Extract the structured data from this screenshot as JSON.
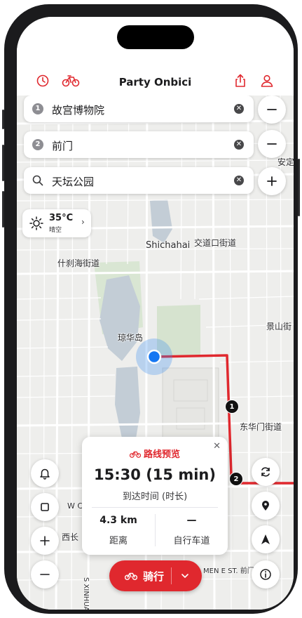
{
  "app": {
    "title": "Party Onbici",
    "accent": "#e0282e"
  },
  "toolbar": {
    "history_icon": "clock-icon",
    "bike_icon": "bicycle-icon",
    "share_icon": "share-icon",
    "account_icon": "person-icon"
  },
  "stops": [
    {
      "badge": "1",
      "label": "故宫博物院"
    },
    {
      "badge": "2",
      "label": "前门"
    },
    {
      "label": "天坛公园",
      "icon": "search-icon"
    }
  ],
  "weather": {
    "temp": "35°C",
    "condition": "晴空",
    "icon": "sun-icon"
  },
  "map_labels": {
    "shichahai_en": "Shichahai",
    "jiaodaokou": "交道口街道",
    "shichahai_street": "什刹海街道",
    "jingshan": "景山街",
    "qionghua": "琼华岛",
    "donghuamen": "东华门街道",
    "anding": "安定",
    "west_road": "W C",
    "xichang": "西长",
    "qianmen": "MEN E ST. 前门",
    "xinhua": "S XINHUA"
  },
  "route_markers": [
    "1",
    "2"
  ],
  "route_card": {
    "title": "路线预览",
    "time": "15:30 (15 min)",
    "time_caption": "到达时间 (时长)",
    "distance": "4.3 km",
    "distance_caption": "距离",
    "lane": "—",
    "lane_caption": "自行车道"
  },
  "ride_button": {
    "label": "骑行"
  }
}
